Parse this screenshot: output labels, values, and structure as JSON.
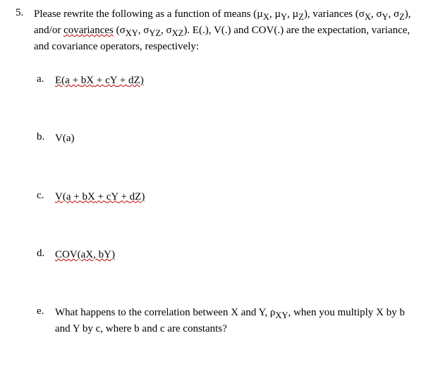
{
  "question": {
    "number": "5.",
    "intro_part1": "Please rewrite the following as a function of means (µ",
    "mx": "X",
    "intro_part2": ", µ",
    "my": "Y",
    "intro_part3": ", µ",
    "mz": "Z",
    "intro_part4": "), variances (σ",
    "vx": "X",
    "intro_part5": ", σ",
    "vy": "Y",
    "intro_part6": ", σ",
    "vz": "Z",
    "intro_part7": "), and/or ",
    "cov_word": "covariances",
    "intro_part8": " (σ",
    "cxy": "XY",
    "intro_part9": ", σ",
    "cyz": "YZ",
    "intro_part10": ", σ",
    "cxz": "XZ",
    "intro_part11": ").  E(.), V(.) and COV(.) are the expectation, variance, and covariance operators, respectively:"
  },
  "parts": {
    "a": {
      "letter": "a.",
      "p1": "E(",
      "p2": "a + ",
      "p3": "bX",
      "p4": " + ",
      "p5": "cY",
      "p6": " + ",
      "p7": "dZ",
      "p8": ")"
    },
    "b": {
      "letter": "b.",
      "text": "V(a)"
    },
    "c": {
      "letter": "c.",
      "p1": "V(",
      "p2": "a + ",
      "p3": "bX",
      "p4": " + ",
      "p5": "cY",
      "p6": " + ",
      "p7": "dZ",
      "p8": ")"
    },
    "d": {
      "letter": "d.",
      "p1": "COV(",
      "p2": "aX",
      "p3": ", ",
      "p4": "bY",
      "p5": ")"
    },
    "e": {
      "letter": "e.",
      "t1": "What happens to the correlation between X and Y, ρ",
      "t2": "XY",
      "t3": ", when you multiply X by b and Y by c, where b and c are constants?"
    }
  }
}
